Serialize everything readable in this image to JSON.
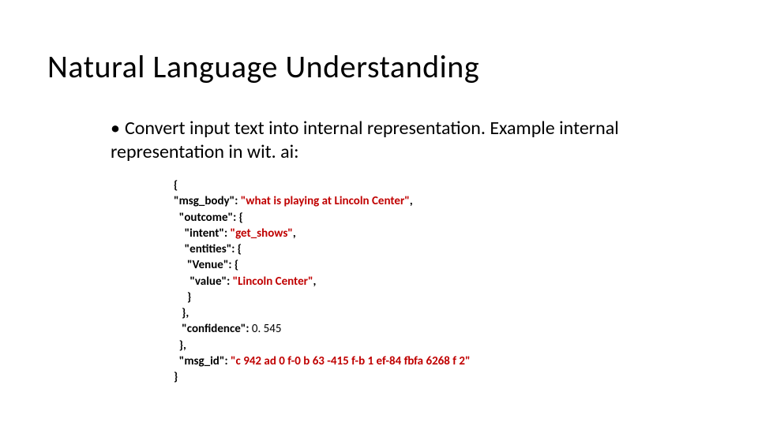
{
  "title": "Natural Language Understanding",
  "bullet": "Convert input text into internal representation. Example internal representation in wit. ai:",
  "code": {
    "l01": "{",
    "l02a": "\"msg_body\": ",
    "l02b": "\"what is playing at Lincoln Center\"",
    "l02c": ",",
    "l03": "  \"outcome\": {",
    "l04a": "    \"intent\": ",
    "l04b": "\"get_shows\"",
    "l04c": ",",
    "l05": "    \"entities\": {",
    "l06": "     \"Venue\": {",
    "l07a": "      \"value\": ",
    "l07b": "\"Lincoln Center\"",
    "l07c": ",",
    "l08": "     }",
    "l09": "   },",
    "l10a": "   \"confidence\": ",
    "l10b": "0. 545",
    "l11": "  },",
    "l12a": "  \"msg_id\": ",
    "l12b": "\"c 942 ad 0 f-0 b 63 -415 f-b 1 ef-84 fbfa 6268 f 2\"",
    "l13": "}"
  }
}
